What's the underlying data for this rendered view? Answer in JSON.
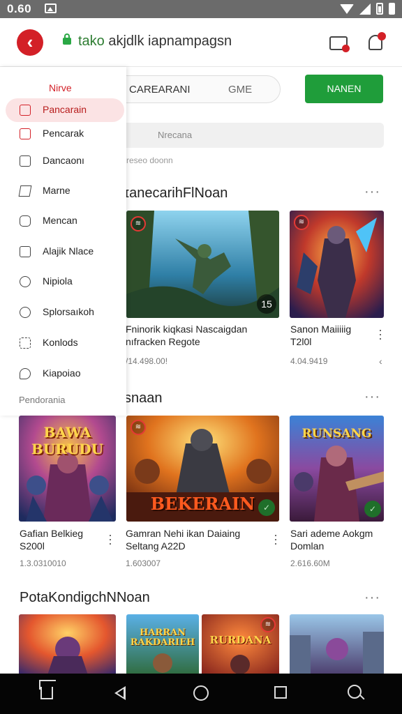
{
  "status_bar": {
    "time": "0.60"
  },
  "top_bar": {
    "url_host": "tako",
    "url_rest": " akjdlk iapnampagsn"
  },
  "filters": {
    "tab1": "CAREARANI",
    "tab2": "GME",
    "green_button": "NANEN"
  },
  "search": {
    "placeholder": "Nrecana",
    "sub_label": "reseo doonn"
  },
  "drawer": {
    "header": "Nirve",
    "items": [
      {
        "label": "Pancarain",
        "active": true
      },
      {
        "label": "Pencarak"
      },
      {
        "label": "Dancaonı"
      },
      {
        "label": "Marne"
      },
      {
        "label": "Mencan"
      },
      {
        "label": "Alajik Nlace"
      },
      {
        "label": "Nipiola"
      },
      {
        "label": "Splorsaıkoh"
      },
      {
        "label": "Konlods"
      },
      {
        "label": "Kiapoiao"
      }
    ],
    "footer": "Pendorania"
  },
  "sections": [
    {
      "title": "ɪanecarihFlNoan",
      "cards": [
        {
          "title_line1": "Fninorik kiqkasi Nascaigdan",
          "title_line2": "nıfracken Regote",
          "meta": "/14.498.00!",
          "count": "15",
          "image": "hero-jungle"
        },
        {
          "title_line1": "Sanon Maiiiiig",
          "title_line2": "T2l0l",
          "meta": "4.04.9419",
          "image": "hero-warrior"
        }
      ]
    },
    {
      "title": "snaan",
      "cards": [
        {
          "title_line1": "Gafian Belkieg",
          "title_line2": "S200l",
          "meta": "1.3.0310010",
          "overlay": "BAWA BURUDU",
          "image": "heroes-burudu"
        },
        {
          "title_line1": "Gamran Nehi ikan Daiaing",
          "title_line2": "Seltang A22D",
          "meta": "1.603007",
          "overlay": "BEKERAIN",
          "image": "hero-bekerain"
        },
        {
          "title_line1": "Sari ademe Aokgm",
          "title_line2": "Domlan",
          "meta": "2.616.60M",
          "overlay": "RUNSANG",
          "image": "heroes-runsang"
        }
      ]
    },
    {
      "title": "PotaKondigchNNoan",
      "cards": [
        {
          "image": "hero-fire"
        },
        {
          "overlay": "HARRAN RAKDARIEH",
          "image": "heroes-harran"
        },
        {
          "overlay": "RURDANA",
          "image": "heroes-rurdana"
        },
        {
          "image": "hero-city"
        }
      ]
    }
  ],
  "icons": {
    "back": "back-arrow-icon",
    "lock": "lock-icon",
    "tabs": "tabs-icon",
    "notification": "notification-bell-icon",
    "more": "more-horizontal-icon",
    "kebab": "more-vertical-icon"
  },
  "colors": {
    "accent": "#d32027",
    "green": "#1f9d3a",
    "drawer_active_bg": "#fbe3e4"
  }
}
